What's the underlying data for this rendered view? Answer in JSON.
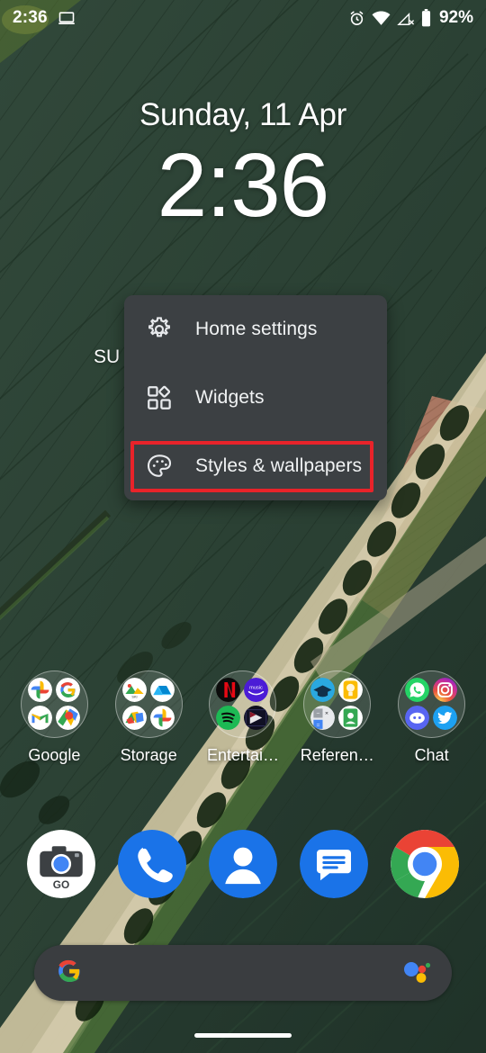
{
  "status_bar": {
    "time": "2:36",
    "battery_percent": "92%",
    "icons": [
      "cast-screen-icon",
      "alarm-icon",
      "wifi-icon",
      "mobile-data-off-icon",
      "battery-icon"
    ]
  },
  "clock_widget": {
    "date": "Sunday, 11 Apr",
    "time": "2:36",
    "weather_text": "SU"
  },
  "popup_menu": {
    "items": [
      {
        "label": "Home settings",
        "icon": "gear-icon",
        "highlighted": false
      },
      {
        "label": "Widgets",
        "icon": "widgets-grid-icon",
        "highlighted": false
      },
      {
        "label": "Styles & wallpapers",
        "icon": "palette-icon",
        "highlighted": true
      }
    ],
    "highlight_color": "#e8232a",
    "background_color": "#3c4043"
  },
  "folders": [
    {
      "label": "Google",
      "apps": [
        "google-photos",
        "google-search",
        "gmail",
        "google-maps"
      ]
    },
    {
      "label": "Storage",
      "apps": [
        "gallery",
        "google-drive",
        "files",
        "google-photos"
      ]
    },
    {
      "label": "Entertai…",
      "apps": [
        "netflix",
        "amazon-music",
        "spotify",
        "prime-video"
      ]
    },
    {
      "label": "Referen…",
      "apps": [
        "google-classroom",
        "google-keep",
        "calculator",
        "google-sheets"
      ]
    },
    {
      "label": "Chat",
      "apps": [
        "whatsapp",
        "instagram",
        "discord",
        "twitter"
      ]
    }
  ],
  "dock": [
    {
      "name": "camera-go"
    },
    {
      "name": "phone"
    },
    {
      "name": "contacts"
    },
    {
      "name": "messages"
    },
    {
      "name": "chrome"
    }
  ],
  "search_bar": {
    "logo": "google-g-icon",
    "assistant": "google-assistant-icon"
  },
  "navigation": {
    "gesture_pill": "home-gesture-pill"
  }
}
